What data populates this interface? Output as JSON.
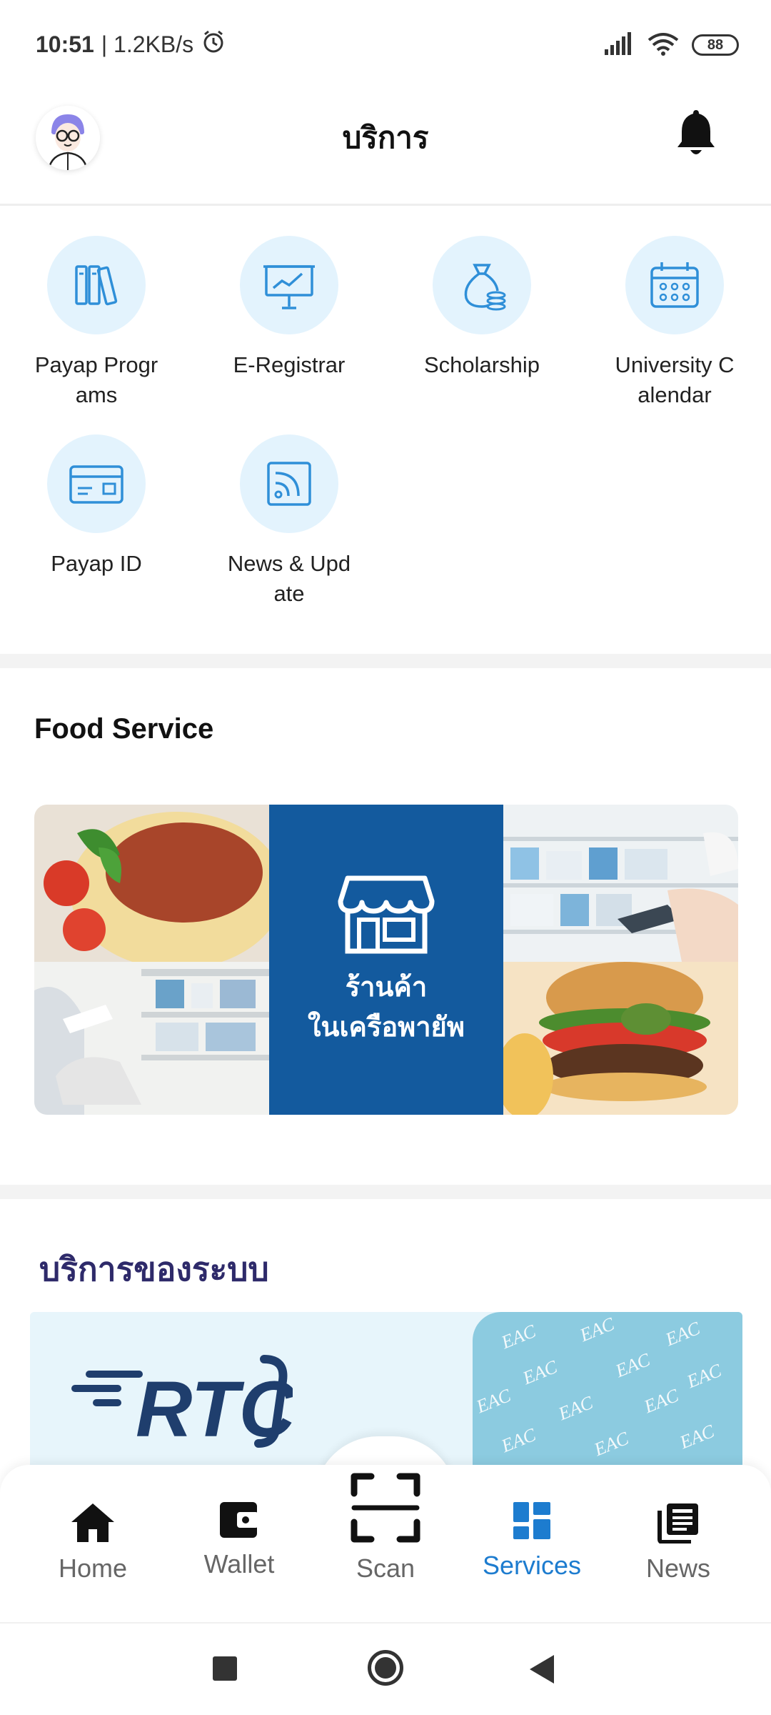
{
  "status_bar": {
    "time": "10:51",
    "speed": "| 1.2KB/s",
    "battery": "88"
  },
  "header": {
    "title": "บริการ"
  },
  "services": [
    {
      "label": "Payap Programs",
      "icon": "books-icon"
    },
    {
      "label": "E-Registrar",
      "icon": "presentation-chart-icon"
    },
    {
      "label": "Scholarship",
      "icon": "money-bag-icon"
    },
    {
      "label": "University Calendar",
      "icon": "calendar-icon"
    },
    {
      "label": "Payap ID",
      "icon": "id-card-icon"
    },
    {
      "label": "News & Update",
      "icon": "rss-icon"
    }
  ],
  "food_section": {
    "title": "Food Service",
    "banner_line1": "ร้านค้า",
    "banner_line2": "ในเครือพายัพ"
  },
  "system_section": {
    "title": "บริการของระบบ",
    "rtc_logo": "RTC",
    "eac_pattern": "EAC"
  },
  "bottom_nav": [
    {
      "label": "Home",
      "icon": "home-icon",
      "active": false
    },
    {
      "label": "Wallet",
      "icon": "wallet-icon",
      "active": false
    },
    {
      "label": "Scan",
      "icon": "scan-icon",
      "active": false
    },
    {
      "label": "Services",
      "icon": "grid-icon",
      "active": true
    },
    {
      "label": "News",
      "icon": "newspaper-icon",
      "active": false
    }
  ],
  "colors": {
    "accent": "#1d7ccf",
    "icon_blue": "#2f8fd8",
    "icon_bg": "#e3f3fd",
    "banner_blue": "#135a9e",
    "system_title": "#2e2a6a"
  }
}
